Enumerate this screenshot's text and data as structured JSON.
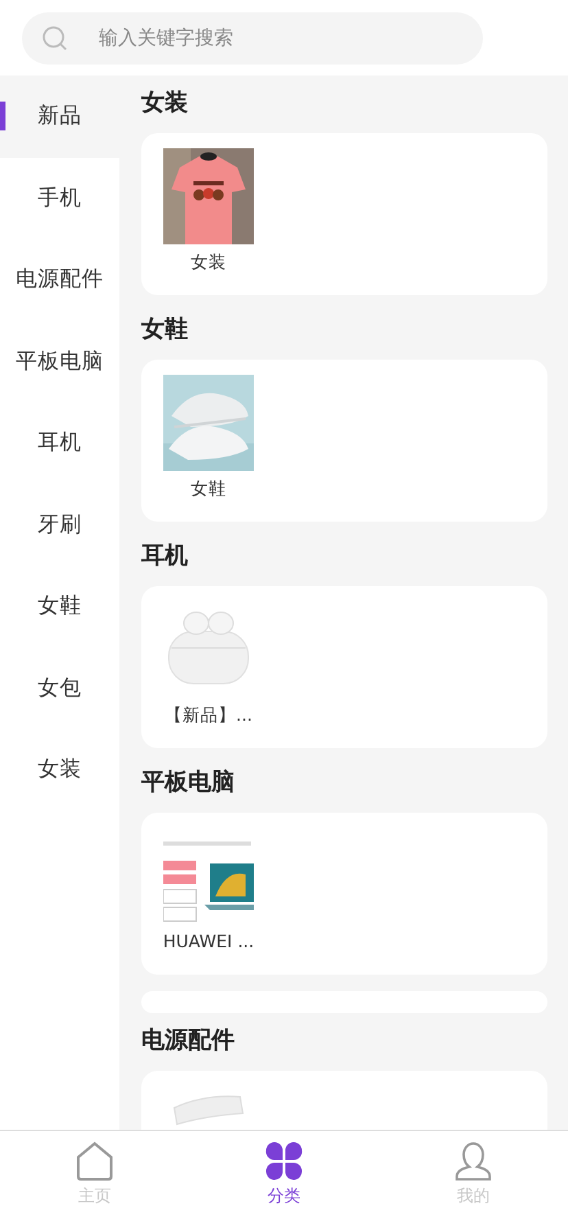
{
  "search": {
    "placeholder": "输入关键字搜索"
  },
  "sidebar": {
    "items": [
      {
        "label": "新品",
        "selected": true
      },
      {
        "label": "手机",
        "selected": false
      },
      {
        "label": "电源配件",
        "selected": false
      },
      {
        "label": "平板电脑",
        "selected": false
      },
      {
        "label": "耳机",
        "selected": false
      },
      {
        "label": "牙刷",
        "selected": false
      },
      {
        "label": "女鞋",
        "selected": false
      },
      {
        "label": "女包",
        "selected": false
      },
      {
        "label": "女装",
        "selected": false
      }
    ]
  },
  "sections": [
    {
      "kind": "category",
      "title": "女装",
      "products": [
        {
          "kind": "tshirt",
          "name": "女装"
        }
      ]
    },
    {
      "kind": "category",
      "title": "女鞋",
      "products": [
        {
          "kind": "shoes",
          "name": "女鞋"
        }
      ]
    },
    {
      "kind": "category",
      "title": "耳机",
      "products": [
        {
          "kind": "earbuds",
          "name": "【新品】..."
        }
      ]
    },
    {
      "kind": "category",
      "title": "平板电脑",
      "products": [
        {
          "kind": "laptop",
          "name": "HUAWEI ..."
        }
      ]
    },
    {
      "kind": "blank"
    },
    {
      "kind": "category",
      "title": "电源配件",
      "products": [
        {
          "kind": "charger"
        }
      ]
    }
  ],
  "tab_bar": [
    {
      "label": "主页",
      "kind": "home",
      "selected": false
    },
    {
      "label": "分类",
      "kind": "category",
      "selected": true
    },
    {
      "label": "我的",
      "kind": "profile",
      "selected": false
    }
  ]
}
